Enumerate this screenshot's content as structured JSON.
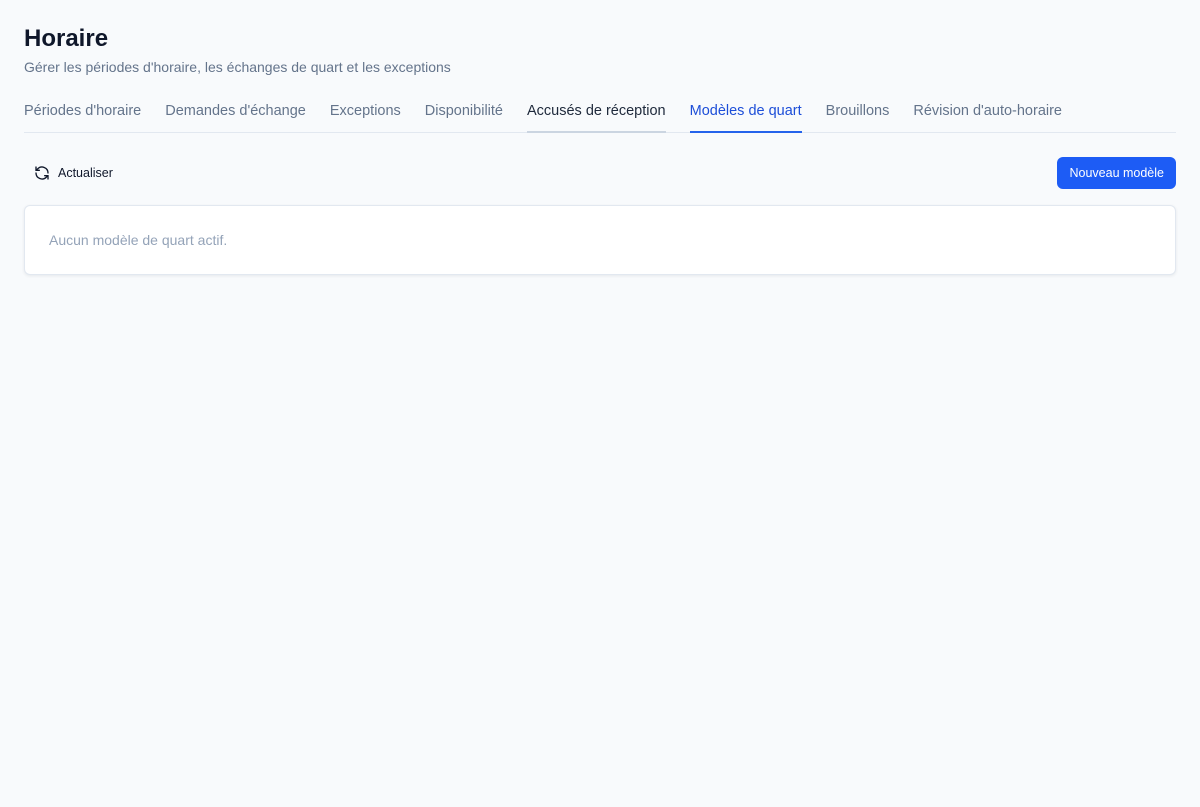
{
  "header": {
    "title": "Horaire",
    "subtitle": "Gérer les périodes d'horaire, les échanges de quart et les exceptions"
  },
  "tabs": [
    {
      "label": "Périodes d'horaire",
      "state": "default"
    },
    {
      "label": "Demandes d'échange",
      "state": "default"
    },
    {
      "label": "Exceptions",
      "state": "default"
    },
    {
      "label": "Disponibilité",
      "state": "default"
    },
    {
      "label": "Accusés de réception",
      "state": "hover"
    },
    {
      "label": "Modèles de quart",
      "state": "active"
    },
    {
      "label": "Brouillons",
      "state": "default"
    },
    {
      "label": "Révision d'auto-horaire",
      "state": "default"
    }
  ],
  "toolbar": {
    "refresh_label": "Actualiser",
    "refresh_icon": "refresh-icon",
    "new_template_label": "Nouveau modèle"
  },
  "content": {
    "empty_message": "Aucun modèle de quart actif."
  },
  "colors": {
    "accent": "#1d5cf5",
    "active_tab": "#1d4ed8",
    "muted_text": "#64748b",
    "background": "#f8fafc"
  }
}
